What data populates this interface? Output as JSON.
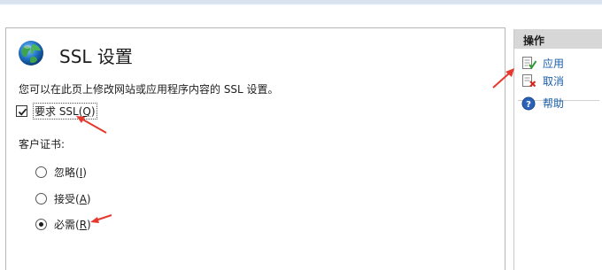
{
  "page": {
    "title": "SSL 设置",
    "description": "您可以在此页上修改网站或应用程序内容的 SSL 设置。"
  },
  "require_ssl": {
    "checked": true,
    "label_prefix": "要求 SSL(",
    "mnemonic": "Q",
    "label_suffix": ")"
  },
  "client_cert": {
    "label": "客户证书:",
    "options": [
      {
        "label_prefix": "忽略(",
        "mnemonic": "I",
        "label_suffix": ")",
        "selected": false
      },
      {
        "label_prefix": "接受(",
        "mnemonic": "A",
        "label_suffix": ")",
        "selected": false
      },
      {
        "label_prefix": "必需(",
        "mnemonic": "R",
        "label_suffix": ")",
        "selected": true
      }
    ]
  },
  "actions": {
    "header": "操作",
    "apply": "应用",
    "cancel": "取消",
    "help": "帮助"
  },
  "colors": {
    "link": "#1a5ea8",
    "annotation_arrow": "#e8382e"
  }
}
